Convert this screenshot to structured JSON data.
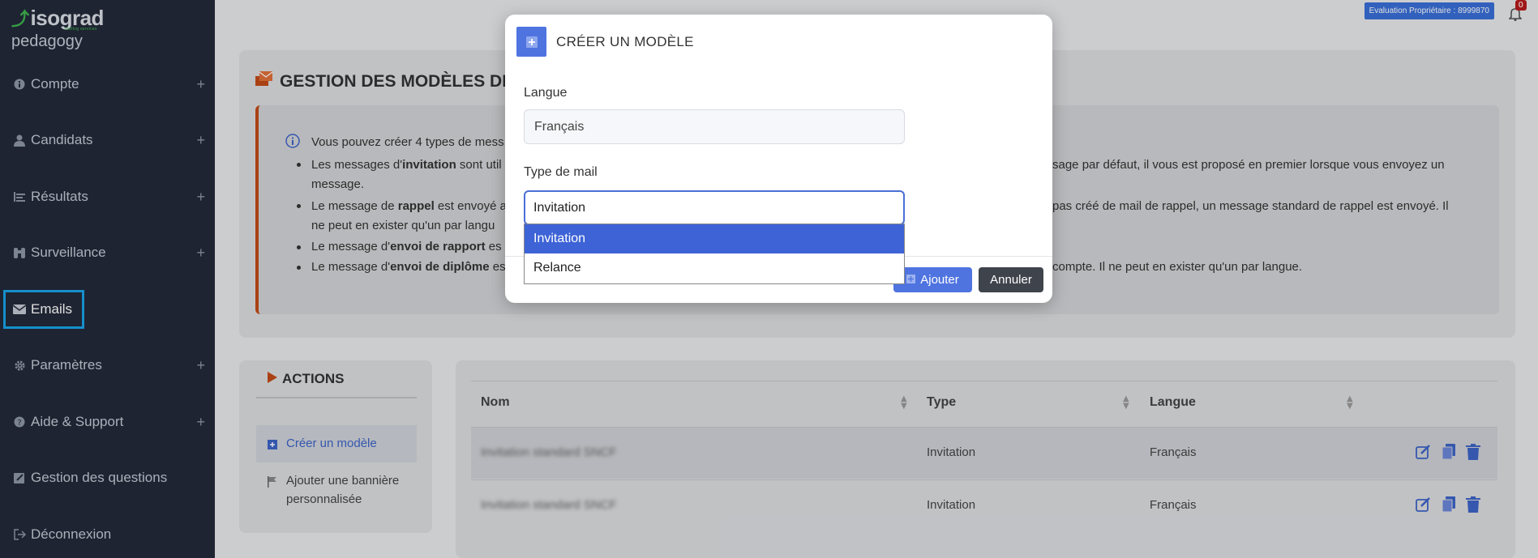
{
  "sidebar": {
    "brand": "isograd",
    "brand_tag": "testing services",
    "product": "pedagogy",
    "items": [
      {
        "label": "Compte",
        "icon": "info-icon",
        "expandable": true
      },
      {
        "label": "Candidats",
        "icon": "user-icon",
        "expandable": true
      },
      {
        "label": "Résultats",
        "icon": "list-icon",
        "expandable": true
      },
      {
        "label": "Surveillance",
        "icon": "binoculars-icon",
        "expandable": true
      },
      {
        "label": "Emails",
        "icon": "envelope-icon",
        "expandable": false,
        "active": true
      },
      {
        "label": "Paramètres",
        "icon": "gear-icon",
        "expandable": true
      },
      {
        "label": "Aide & Support",
        "icon": "question-icon",
        "expandable": true
      },
      {
        "label": "Gestion des questions",
        "icon": "edit-icon",
        "expandable": false
      },
      {
        "label": "Déconnexion",
        "icon": "logout-icon",
        "expandable": false
      }
    ],
    "plus": "+"
  },
  "topbar": {
    "eval_label": "Evaluation Propriétaire : 8999870",
    "notifications": "0"
  },
  "main": {
    "title": "GESTION DES MODÈLES DE M",
    "info": {
      "intro": "Vous pouvez créer 4 types de mess",
      "b1_pre": "Les messages d'",
      "b1_bold": "invitation",
      "b1_post": " sont util",
      "b1_right": "sage par défaut, il vous est proposé en premier lorsque vous envoyez un",
      "b1_line2": "message.",
      "b2_pre": "Le message de ",
      "b2_bold": "rappel",
      "b2_post": " est envoyé a",
      "b2_right": "pas créé de mail de rappel, un message standard de rappel est envoyé. Il",
      "b2_line2": "ne peut en exister qu'un par langu",
      "b3_pre": "Le message d'",
      "b3_bold": "envoi de rapport",
      "b3_post": " es",
      "b4_pre": "Le message d'",
      "b4_bold": "envoi de diplôme",
      "b4_post": " es",
      "b4_right": "compte. Il ne peut en exister qu'un par langue."
    },
    "actions": {
      "title": "ACTIONS",
      "items": [
        {
          "label": "Créer un modèle",
          "selected": true
        },
        {
          "label_line1": "Ajouter une bannière",
          "label_line2": "personnalisée"
        }
      ]
    },
    "table": {
      "headers": [
        "Nom",
        "Type",
        "Langue"
      ],
      "rows": [
        {
          "nom": "Invitation standard SNCF",
          "type": "Invitation",
          "langue": "Français"
        },
        {
          "nom": "Invitation standard SNCF",
          "type": "Invitation",
          "langue": "Français"
        }
      ]
    }
  },
  "modal": {
    "title": "CRÉER UN MODÈLE",
    "langue_label": "Langue",
    "langue_value": "Français",
    "type_label": "Type de mail",
    "type_value": "Invitation",
    "options": [
      "Invitation",
      "Relance"
    ],
    "add_label": "Ajouter",
    "cancel_label": "Annuler"
  },
  "colors": {
    "sidebar_bg": "#232a3a",
    "accent": "#4f74e0",
    "highlight": "#1aa3e8",
    "warning_border": "#c24a17"
  }
}
